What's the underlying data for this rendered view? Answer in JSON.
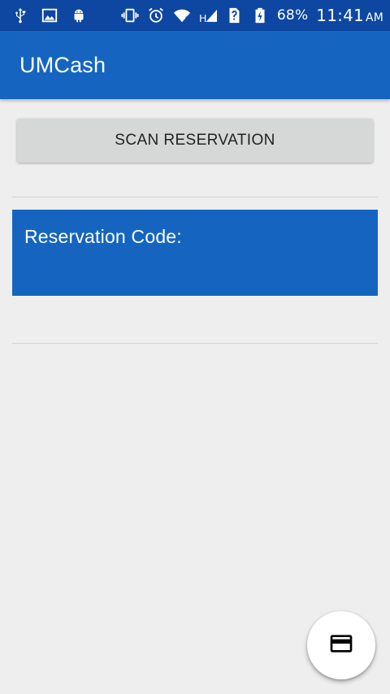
{
  "status_bar": {
    "battery_percent": "68%",
    "time": "11:41",
    "ampm": "AM",
    "network_type": "H",
    "icons_left": [
      "usb-icon",
      "image-icon",
      "android-icon"
    ],
    "icons_right": [
      "vibrate-icon",
      "alarm-icon",
      "wifi-icon",
      "signal-icon",
      "sim-unknown-icon",
      "battery-charging-icon"
    ]
  },
  "app_bar": {
    "title": "UMCash"
  },
  "main": {
    "scan_button_label": "SCAN RESERVATION",
    "reservation_label": "Reservation Code:"
  },
  "fab": {
    "icon": "credit-card-icon"
  },
  "colors": {
    "status_bar": "#0d47a1",
    "app_bar": "#1565c0",
    "panel": "#1565c0",
    "background": "#eeeeee",
    "button": "#d6d7d7"
  }
}
